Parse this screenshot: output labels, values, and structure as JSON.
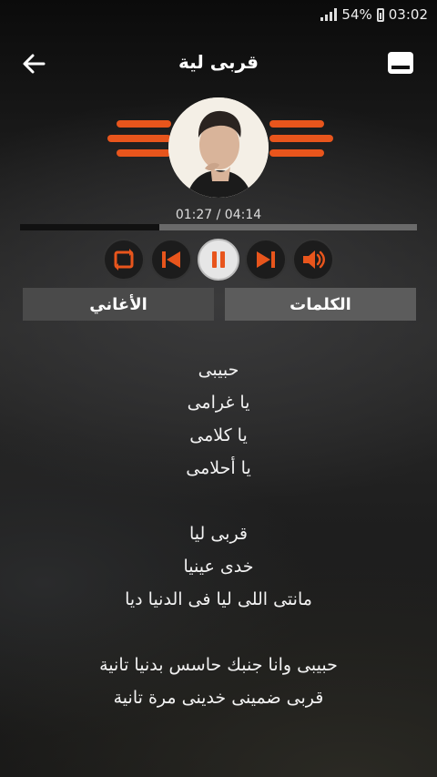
{
  "status": {
    "battery": "54%",
    "time": "03:02",
    "icons": [
      "signal-icon",
      "battery-icon"
    ]
  },
  "header": {
    "title": "قربى لية",
    "back_icon": "arrow-left-icon",
    "menu_icon": "menu-icon"
  },
  "player": {
    "elapsed_total": "01:27 / 04:14",
    "progress": 0.35,
    "accent_color": "#e8551c",
    "controls": [
      "repeat-icon",
      "previous-icon",
      "pause-icon",
      "next-icon",
      "volume-icon"
    ]
  },
  "tabs": {
    "lyrics_label": "الكلمات",
    "songs_label": "الأغاني"
  },
  "lyrics": {
    "stanzas": [
      [
        "حبيبى",
        "يا غرامى",
        "يا كلامى",
        "يا أحلامى"
      ],
      [
        "قربى ليا",
        "خدى عينيا",
        "مانتى اللى ليا فى الدنيا ديا"
      ],
      [
        "حبيبى وانا جنبك حاسس بدنيا تانية",
        "قربى ضمينى خدينى مرة تانية"
      ]
    ]
  }
}
